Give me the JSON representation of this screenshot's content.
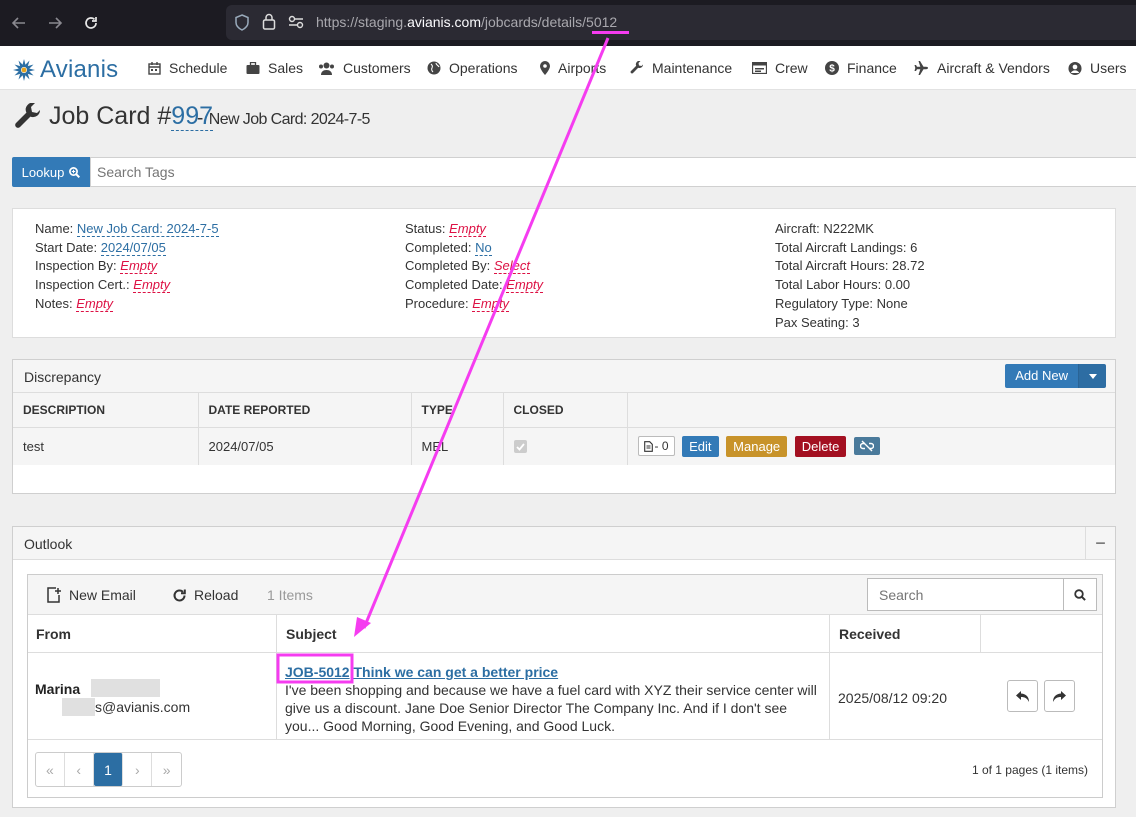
{
  "browser": {
    "url_prefix": "https://staging.",
    "url_domain": "avianis.com",
    "url_path": "/jobcards/details/",
    "url_id": "5012"
  },
  "nav": {
    "logo_text": "Avianis",
    "items": [
      {
        "label": "Schedule",
        "icon": "calendar-icon"
      },
      {
        "label": "Sales",
        "icon": "briefcase-icon"
      },
      {
        "label": "Customers",
        "icon": "users-icon"
      },
      {
        "label": "Operations",
        "icon": "globe-icon"
      },
      {
        "label": "Airports",
        "icon": "map-marker-icon"
      },
      {
        "label": "Maintenance",
        "icon": "wrench-icon"
      },
      {
        "label": "Crew",
        "icon": "id-card-icon"
      },
      {
        "label": "Finance",
        "icon": "dollar-icon"
      },
      {
        "label": "Aircraft & Vendors",
        "icon": "plane-icon"
      },
      {
        "label": "Users",
        "icon": "user-circle-icon"
      }
    ]
  },
  "header": {
    "title_prefix": "Job Card #",
    "job_number": "997",
    "separator": "-",
    "subtitle": "New Job Card: 2024-7-5"
  },
  "lookup": {
    "button_label": "Lookup",
    "placeholder": "Search Tags"
  },
  "details": {
    "col1": {
      "name_label": "Name:",
      "name_value": "New Job Card: 2024-7-5",
      "start_label": "Start Date:",
      "start_value": "2024/07/05",
      "inspection_by_label": "Inspection By:",
      "inspection_by_value": "Empty",
      "inspection_cert_label": "Inspection Cert.:",
      "inspection_cert_value": "Empty",
      "notes_label": "Notes:",
      "notes_value": "Empty"
    },
    "col2": {
      "status_label": "Status:",
      "status_value": "Empty",
      "completed_label": "Completed:",
      "completed_value": "No",
      "completed_by_label": "Completed By:",
      "completed_by_value": "Select",
      "completed_date_label": "Completed Date:",
      "completed_date_value": "Empty",
      "procedure_label": "Procedure:",
      "procedure_value": "Empty"
    },
    "col3": {
      "aircraft": "Aircraft: N222MK",
      "landings": "Total Aircraft Landings: 6",
      "hours": "Total Aircraft Hours: 28.72",
      "labor": "Total Labor Hours: 0.00",
      "regulatory": "Regulatory Type: None",
      "pax": "Pax Seating: 3"
    }
  },
  "discrepancy": {
    "title": "Discrepancy",
    "add_new_label": "Add New",
    "columns": [
      "DESCRIPTION",
      "DATE REPORTED",
      "TYPE",
      "CLOSED"
    ],
    "rows": [
      {
        "description": "test",
        "date": "2024/07/05",
        "type": "MEL",
        "closed": true,
        "files": "- 0"
      }
    ],
    "actions": {
      "edit": "Edit",
      "manage": "Manage",
      "delete": "Delete"
    }
  },
  "outlook": {
    "title": "Outlook",
    "collapse_symbol": "−",
    "toolbar": {
      "new_email": "New Email",
      "reload": "Reload",
      "count": "1 Items",
      "search_placeholder": "Search"
    },
    "columns": {
      "from": "From",
      "subject": "Subject",
      "received": "Received"
    },
    "email": {
      "from_name": "Marina",
      "from_email_suffix": "s@avianis.com",
      "subject_tag": "JOB-5012",
      "subject_text": "Think we can get a better price",
      "preview": "I've been shopping and because we have a fuel card with XYZ their service center will give us a discount.   Jane Doe Senior Director The Company Inc.  And if I don't see you... Good Morning, Good Evening, and Good Luck.",
      "received": "2025/08/12 09:20"
    },
    "pager": {
      "first": "«",
      "prev": "‹",
      "current": "1",
      "next": "›",
      "last": "»",
      "info": "1 of 1 pages (1 items)"
    }
  },
  "annotation": {
    "color": "#f53cf0"
  }
}
